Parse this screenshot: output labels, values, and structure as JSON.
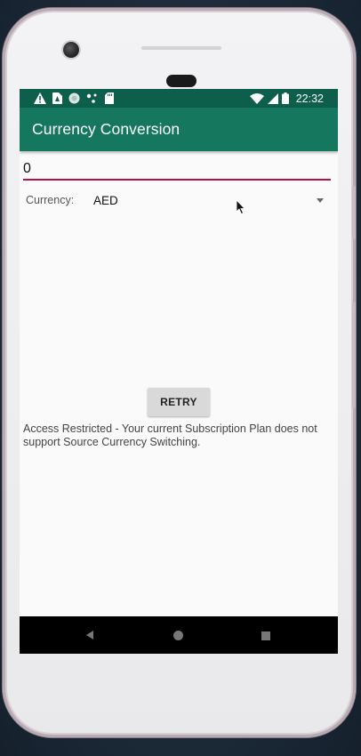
{
  "status_bar": {
    "time": "22:32",
    "left_icons": [
      "warning-icon",
      "sim-card-alert-icon",
      "circle-app-icon",
      "dots-icon",
      "sd-card-icon"
    ],
    "right_icons": [
      "wifi-icon",
      "cell-signal-icon",
      "battery-icon"
    ]
  },
  "app_bar": {
    "title": "Currency Conversion"
  },
  "amount_input": {
    "value": "0"
  },
  "currency": {
    "label": "Currency:",
    "selected": "AED"
  },
  "retry_button": {
    "label": "RETRY"
  },
  "message": {
    "text": "Access Restricted - Your current Subscription Plan does not support Source Currency Switching."
  },
  "nav_bar": {
    "icons": [
      "back-icon",
      "home-icon",
      "recents-icon"
    ]
  },
  "colors": {
    "status_bar": "#0e5e4c",
    "app_bar": "#16775f",
    "accent_underline": "#b0124c",
    "button_bg": "#d9d9d9"
  }
}
